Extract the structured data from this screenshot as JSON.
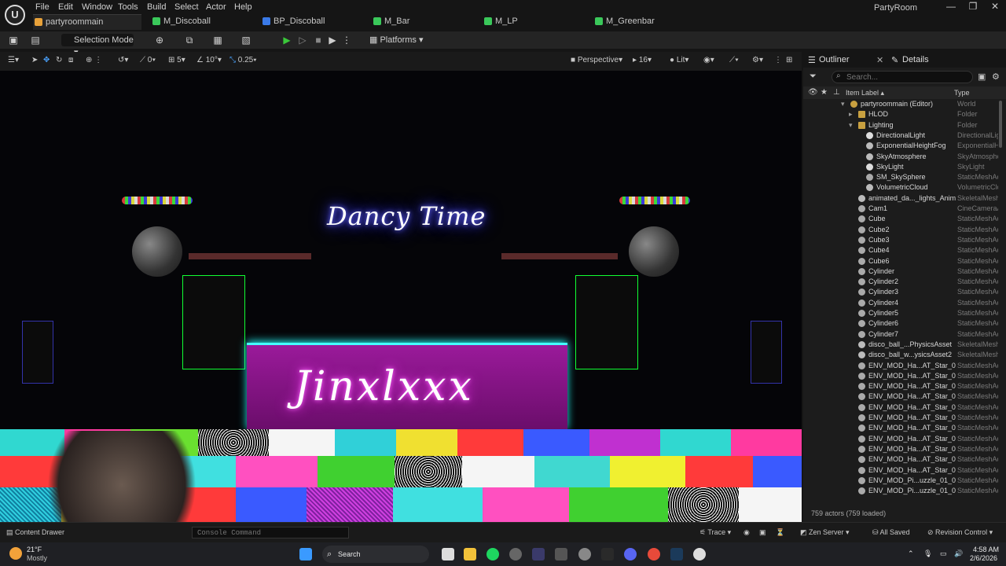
{
  "menu": {
    "items": [
      "File",
      "Edit",
      "Window",
      "Tools",
      "Build",
      "Select",
      "Actor",
      "Help"
    ],
    "window_title": "PartyRoom"
  },
  "tabs": [
    {
      "label": "partyroommain",
      "color": "#e8a23a"
    },
    {
      "label": "M_Discoball",
      "color": "#3ac85a"
    },
    {
      "label": "BP_Discoball",
      "color": "#3a7ae8"
    },
    {
      "label": "M_Bar",
      "color": "#3ac85a"
    },
    {
      "label": "M_LP",
      "color": "#3ac85a"
    },
    {
      "label": "M_Greenbar",
      "color": "#3ac85a"
    }
  ],
  "toolbar": {
    "selection_mode": "Selection Mode",
    "platforms": "Platforms"
  },
  "viewport_toolbar": {
    "snap_angle": "0",
    "snap_grid": "5",
    "rotation_snap": "10°",
    "scale_snap": "0.25",
    "view_mode": "Perspective",
    "fov": "16",
    "lighting": "Lit"
  },
  "scene": {
    "title_sign": "Dancy Time",
    "booth_sign": "Jinxlxxx"
  },
  "outliner": {
    "tab_label": "Outliner",
    "details_label": "Details",
    "search_placeholder": "Search...",
    "col_label": "Item Label",
    "col_type": "Type",
    "items": [
      {
        "label": "partyroommain (Editor)",
        "type": "World",
        "indent": 0,
        "icon": "world-icon"
      },
      {
        "label": "HLOD",
        "type": "Folder",
        "indent": 1,
        "icon": "folder-icon"
      },
      {
        "label": "Lighting",
        "type": "Folder",
        "indent": 1,
        "icon": "folder-icon"
      },
      {
        "label": "DirectionalLight",
        "type": "DirectionalLig",
        "indent": 2,
        "icon": "light-icon"
      },
      {
        "label": "ExponentialHeightFog",
        "type": "ExponentialHe",
        "indent": 2,
        "icon": "fog-icon"
      },
      {
        "label": "SkyAtmosphere",
        "type": "SkyAtmosphe",
        "indent": 2,
        "icon": "atmosphere-icon"
      },
      {
        "label": "SkyLight",
        "type": "SkyLight",
        "indent": 2,
        "icon": "light-icon"
      },
      {
        "label": "SM_SkySphere",
        "type": "StaticMeshAc",
        "indent": 2,
        "icon": "mesh-icon"
      },
      {
        "label": "VolumetricCloud",
        "type": "VolumetricClo",
        "indent": 2,
        "icon": "cloud-icon"
      },
      {
        "label": "animated_da..._lights_Anim",
        "type": "SkeletalMesh",
        "indent": 1,
        "icon": "skeletal-icon"
      },
      {
        "label": "Cam1",
        "type": "CineCameraA",
        "indent": 1,
        "icon": "camera-icon"
      },
      {
        "label": "Cube",
        "type": "StaticMeshAc",
        "indent": 1,
        "icon": "mesh-icon"
      },
      {
        "label": "Cube2",
        "type": "StaticMeshAc",
        "indent": 1,
        "icon": "mesh-icon"
      },
      {
        "label": "Cube3",
        "type": "StaticMeshAc",
        "indent": 1,
        "icon": "mesh-icon"
      },
      {
        "label": "Cube4",
        "type": "StaticMeshAc",
        "indent": 1,
        "icon": "mesh-icon"
      },
      {
        "label": "Cube6",
        "type": "StaticMeshAc",
        "indent": 1,
        "icon": "mesh-icon"
      },
      {
        "label": "Cylinder",
        "type": "StaticMeshAc",
        "indent": 1,
        "icon": "mesh-icon"
      },
      {
        "label": "Cylinder2",
        "type": "StaticMeshAc",
        "indent": 1,
        "icon": "mesh-icon"
      },
      {
        "label": "Cylinder3",
        "type": "StaticMeshAc",
        "indent": 1,
        "icon": "mesh-icon"
      },
      {
        "label": "Cylinder4",
        "type": "StaticMeshAc",
        "indent": 1,
        "icon": "mesh-icon"
      },
      {
        "label": "Cylinder5",
        "type": "StaticMeshAc",
        "indent": 1,
        "icon": "mesh-icon"
      },
      {
        "label": "Cylinder6",
        "type": "StaticMeshAc",
        "indent": 1,
        "icon": "mesh-icon"
      },
      {
        "label": "Cylinder7",
        "type": "StaticMeshAc",
        "indent": 1,
        "icon": "mesh-icon"
      },
      {
        "label": "disco_ball_...PhysicsAsset",
        "type": "SkeletalMesh",
        "indent": 1,
        "icon": "skeletal-icon"
      },
      {
        "label": "disco_ball_w...ysicsAsset2",
        "type": "SkeletalMesh",
        "indent": 1,
        "icon": "skeletal-icon"
      },
      {
        "label": "ENV_MOD_Ha...AT_Star_0",
        "type": "StaticMeshAc",
        "indent": 1,
        "icon": "mesh-icon"
      },
      {
        "label": "ENV_MOD_Ha...AT_Star_0",
        "type": "StaticMeshAc",
        "indent": 1,
        "icon": "mesh-icon"
      },
      {
        "label": "ENV_MOD_Ha...AT_Star_0",
        "type": "StaticMeshAc",
        "indent": 1,
        "icon": "mesh-icon"
      },
      {
        "label": "ENV_MOD_Ha...AT_Star_0",
        "type": "StaticMeshAc",
        "indent": 1,
        "icon": "mesh-icon"
      },
      {
        "label": "ENV_MOD_Ha...AT_Star_0",
        "type": "StaticMeshAc",
        "indent": 1,
        "icon": "mesh-icon"
      },
      {
        "label": "ENV_MOD_Ha...AT_Star_0",
        "type": "StaticMeshAc",
        "indent": 1,
        "icon": "mesh-icon"
      },
      {
        "label": "ENV_MOD_Ha...AT_Star_0",
        "type": "StaticMeshAc",
        "indent": 1,
        "icon": "mesh-icon"
      },
      {
        "label": "ENV_MOD_Ha...AT_Star_0",
        "type": "StaticMeshAc",
        "indent": 1,
        "icon": "mesh-icon"
      },
      {
        "label": "ENV_MOD_Ha...AT_Star_0",
        "type": "StaticMeshAc",
        "indent": 1,
        "icon": "mesh-icon"
      },
      {
        "label": "ENV_MOD_Ha...AT_Star_0",
        "type": "StaticMeshAc",
        "indent": 1,
        "icon": "mesh-icon"
      },
      {
        "label": "ENV_MOD_Ha...AT_Star_0",
        "type": "StaticMeshAc",
        "indent": 1,
        "icon": "mesh-icon"
      },
      {
        "label": "ENV_MOD_Pi...uzzle_01_0",
        "type": "StaticMeshAc",
        "indent": 1,
        "icon": "mesh-icon"
      },
      {
        "label": "ENV_MOD_Pi...uzzle_01_0",
        "type": "StaticMeshAc",
        "indent": 1,
        "icon": "mesh-icon"
      }
    ],
    "actor_count": "759 actors (759 loaded)"
  },
  "statusbar": {
    "content_drawer": "Content Drawer",
    "console_placeholder": "Console Command",
    "trace": "Trace",
    "zen_server": "Zen Server",
    "all_saved": "All Saved",
    "revision_control": "Revision Control"
  },
  "taskbar": {
    "weather_temp": "21°F",
    "weather_desc": "Mostly",
    "search": "Search",
    "time": "4:58 AM",
    "date": "2/6/2026"
  }
}
